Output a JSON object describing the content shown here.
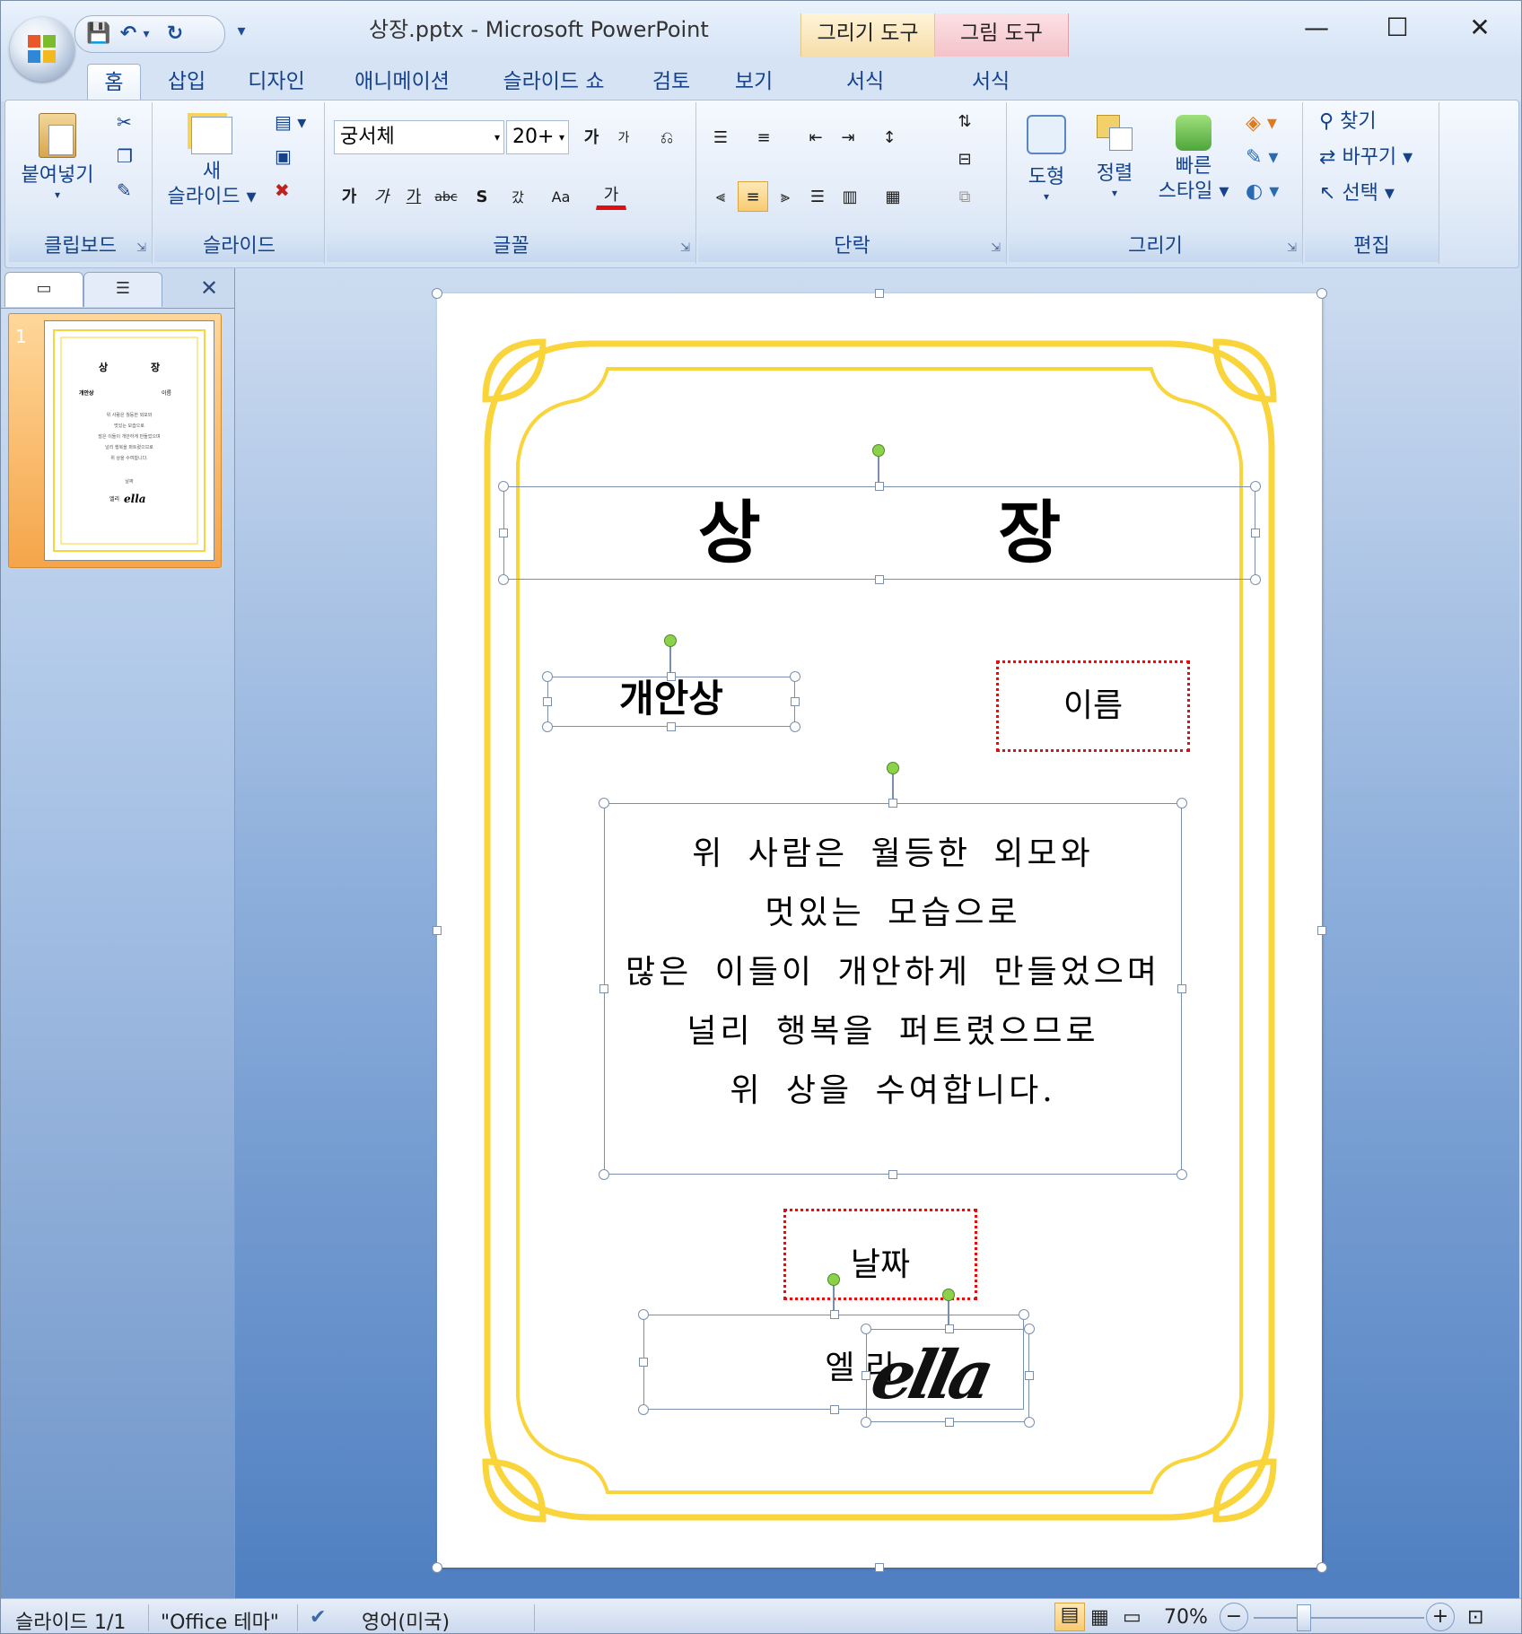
{
  "window": {
    "title": "상장.pptx - Microsoft PowerPoint",
    "context_tabs": [
      "그리기 도구",
      "그림 도구"
    ],
    "controls": {
      "minimize": "—",
      "maximize": "☐",
      "close": "✕"
    }
  },
  "quick_access": {
    "save": "💾",
    "undo": "↶",
    "redo": "↻",
    "customize": "▾"
  },
  "tabs": [
    "홈",
    "삽입",
    "디자인",
    "애니메이션",
    "슬라이드 쇼",
    "검토",
    "보기",
    "서식",
    "서식"
  ],
  "ribbon": {
    "clipboard": {
      "paste": "붙여넣기",
      "label": "클립보드"
    },
    "slides": {
      "new_slide_line1": "새",
      "new_slide_line2": "슬라이드",
      "label": "슬라이드"
    },
    "font": {
      "name": "궁서체",
      "size": "20+",
      "grow": "가",
      "shrink": "가",
      "bold": "가",
      "italic": "가",
      "underline": "가",
      "strike": "abc",
      "shadow": "S",
      "spacing": "갔",
      "case": "Aa",
      "color": "가",
      "label": "글꼴"
    },
    "paragraph": {
      "label": "단락"
    },
    "drawing": {
      "shapes": "도형",
      "arrange": "정렬",
      "quick_styles_line1": "빠른",
      "quick_styles_line2": "스타일",
      "label": "그리기"
    },
    "editing": {
      "find": "찾기",
      "replace": "바꾸기",
      "select": "선택",
      "label": "편집"
    }
  },
  "slide_panel": {
    "slide_number": "1"
  },
  "slide": {
    "title": "상          장",
    "award": "개안상",
    "name_placeholder": "이름",
    "body_lines": [
      "위 사람은 월등한 외모와",
      "멋있는 모습으로",
      "많은 이들이 개안하게 만들었으며",
      "널리 행복을 퍼트렸으므로",
      "위 상을 수여합니다."
    ],
    "date_placeholder": "날짜",
    "signer": "엘 리",
    "signature": "ella"
  },
  "status_bar": {
    "slide_info": "슬라이드 1/1",
    "theme": "\"Office 테마\"",
    "language": "영어(미국)",
    "zoom": "70%"
  },
  "colors": {
    "frame_gold": "#f9d43a",
    "dotted_red": "#e01010",
    "ribbon_text": "#15428b"
  }
}
